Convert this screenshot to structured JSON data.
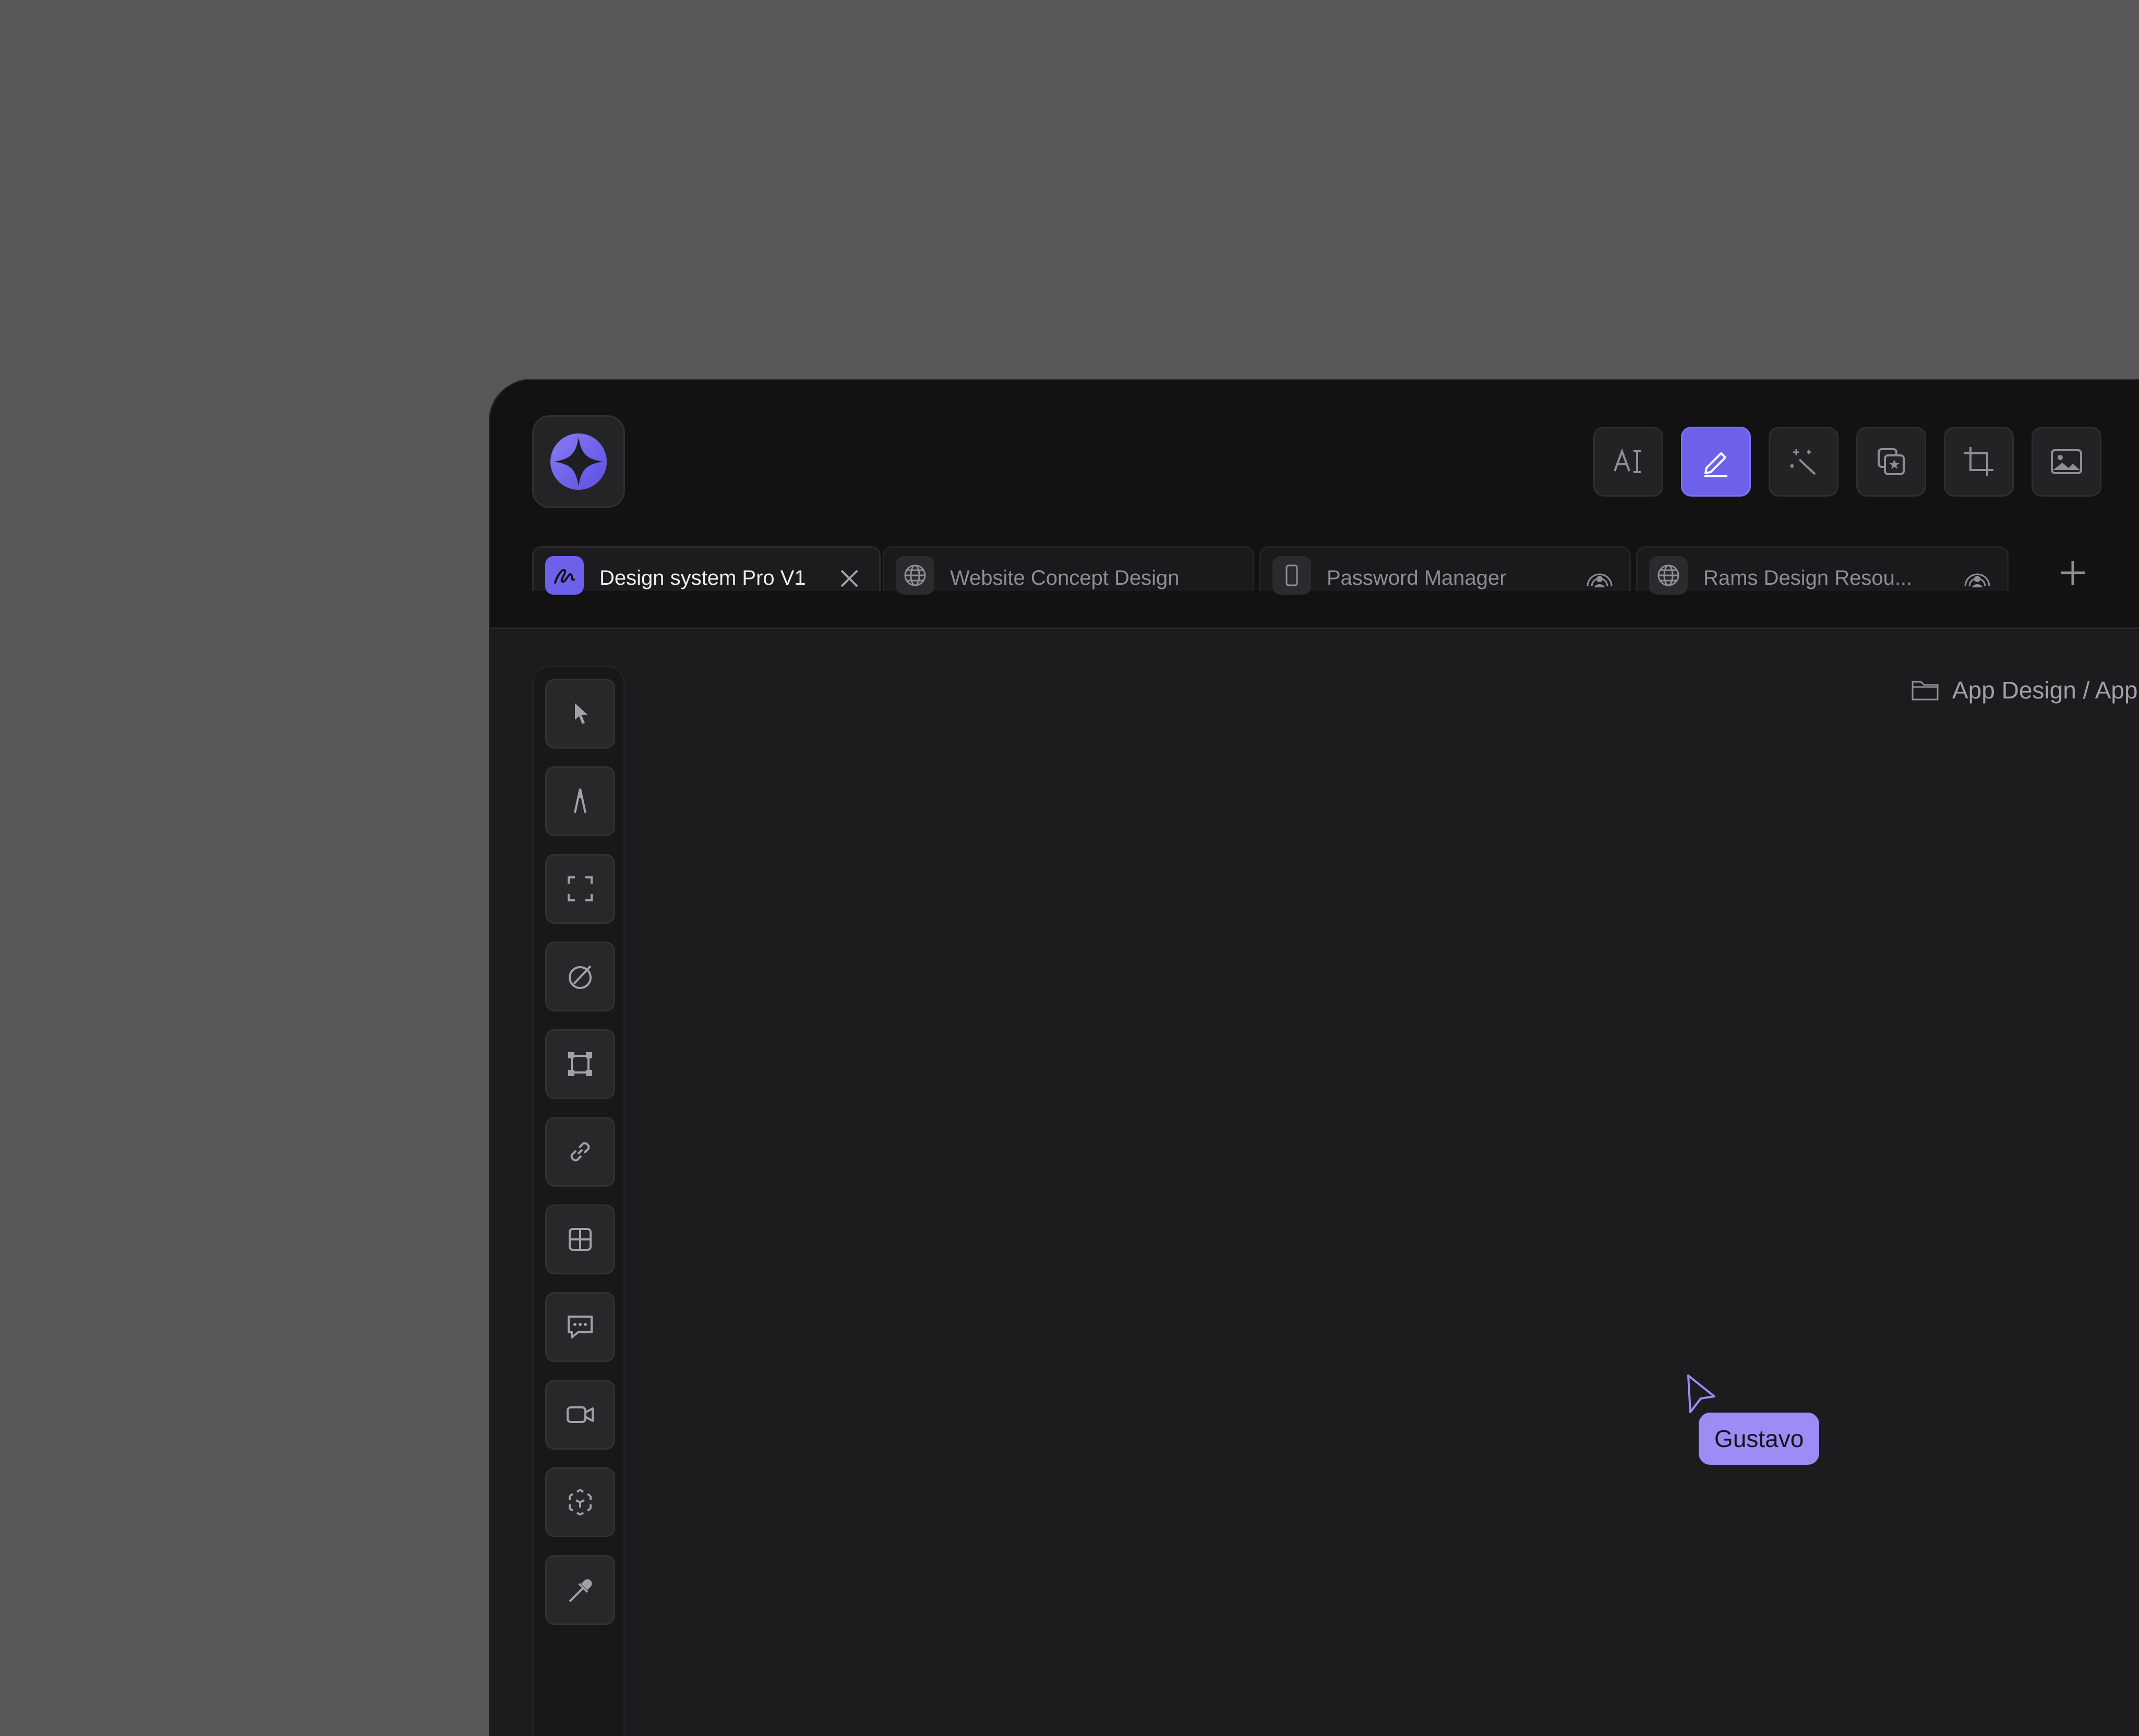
{
  "tabs": [
    {
      "label": "Design system Pro V1",
      "icon": "scribble-icon",
      "active": true,
      "trailing": "close-icon"
    },
    {
      "label": "Website Concept Design",
      "icon": "globe-icon",
      "active": false,
      "trailing": ""
    },
    {
      "label": "Password Manager",
      "icon": "mobile-icon",
      "active": false,
      "trailing": "shared-icon"
    },
    {
      "label": "Rams Design Resou...",
      "icon": "globe-icon",
      "active": false,
      "trailing": "shared-icon"
    }
  ],
  "top_tools": [
    "text-style-icon",
    "pen-edit-icon",
    "magic-wand-icon",
    "favorites-icon",
    "crop-icon",
    "image-icon"
  ],
  "side_tools": [
    "select-icon",
    "pen-tool-icon",
    "frame-icon",
    "no-fill-icon",
    "transform-icon",
    "link-icon",
    "grid-icon",
    "comment-icon",
    "video-icon",
    "3d-object-icon",
    "eyedropper-icon"
  ],
  "breadcrumb": {
    "path": "App Design / App"
  },
  "collaborator": {
    "name": "Gustavo",
    "color": "#9d8cf6"
  },
  "colors": {
    "accent": "#6d61ea",
    "background": "#58585a",
    "canvas": "#1c1c1e",
    "window": "#121213"
  }
}
